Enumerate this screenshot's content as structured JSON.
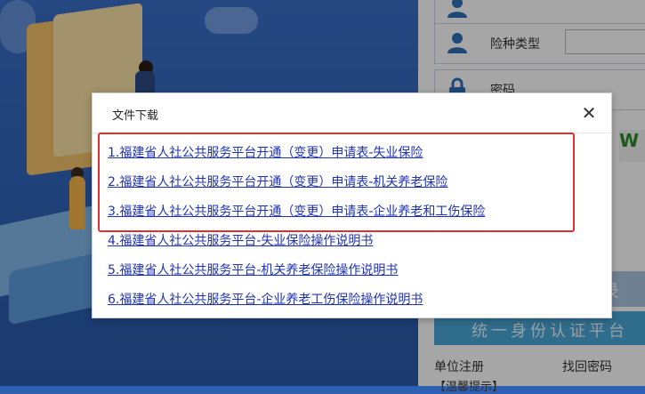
{
  "login_panel": {
    "insurance_type_label": "险种类型",
    "password_label": "密码",
    "captcha_text": "W",
    "login_button": "录",
    "cert_button": "统一身份认证平台",
    "register_link": "单位注册",
    "forgot_link": "找回密码",
    "tip_text": "【温馨提示】"
  },
  "modal": {
    "title": "文件下载",
    "close_icon": "close-icon",
    "files": [
      "1.福建省人社公共服务平台开通（变更）申请表-失业保险",
      "2.福建省人社公共服务平台开通（变更）申请表-机关养老保险",
      "3.福建省人社公共服务平台开通（变更）申请表-企业养老和工伤保险",
      "4.福建省人社公共服务平台-失业保险操作说明书",
      "5.福建省人社公共服务平台-机关养老保险操作说明书",
      "6.福建省人社公共服务平台-企业养老工伤保险操作说明书"
    ]
  },
  "colors": {
    "link": "#1f33b5",
    "highlight": "#e03030",
    "background": "#2d5fb3"
  }
}
